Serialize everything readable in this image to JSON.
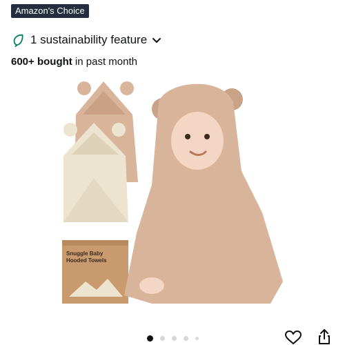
{
  "badge": {
    "label": "Amazon's Choice"
  },
  "sustainability": {
    "label": "1 sustainability feature",
    "icon": "leaf-icon",
    "chevron": "chevron-down-icon"
  },
  "bought": {
    "count": "600+ bought",
    "suffix": " in past month"
  },
  "product": {
    "box_title_line1": "Snuggle Baby",
    "box_title_line2": "Hooded Towels",
    "colors": {
      "towel": "#d8b49a",
      "cream": "#ece4cf",
      "box": "#c89a6e"
    }
  },
  "carousel": {
    "count": 5,
    "active_index": 0
  },
  "actions": {
    "favorite_icon": "heart-icon",
    "share_icon": "share-icon"
  },
  "colors": {
    "badge_bg": "#232f3e",
    "leaf": "#067d62"
  }
}
